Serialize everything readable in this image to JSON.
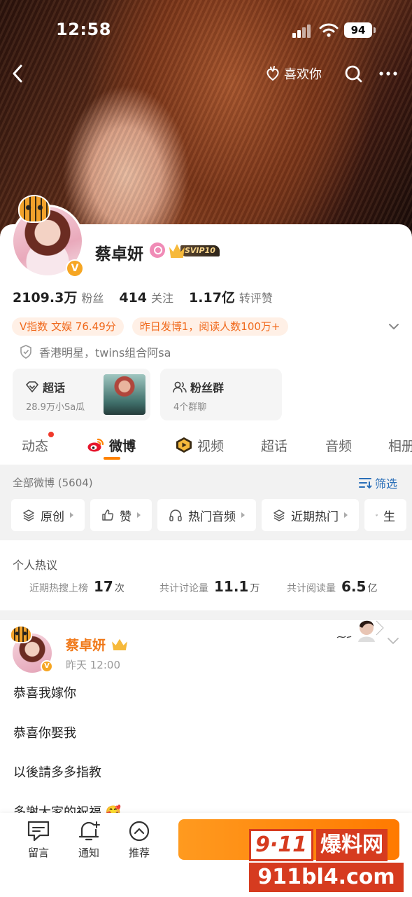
{
  "status_bar": {
    "time": "12:58",
    "battery": "94"
  },
  "nav": {
    "like_label": "喜欢你"
  },
  "profile": {
    "name": "蔡卓妍",
    "svip_label": "SVIP10",
    "stats": [
      {
        "value": "2109.3万",
        "label": "粉丝"
      },
      {
        "value": "414",
        "label": "关注"
      },
      {
        "value": "1.17亿",
        "label": "转评赞"
      }
    ],
    "chips": [
      "V指数 文娱 76.49分",
      "昨日发博1，阅读人数100万+"
    ],
    "intro": "香港明星，twins组合阿sa",
    "boxes": [
      {
        "title": "超话",
        "subtitle": "28.9万小Sa瓜"
      },
      {
        "title": "粉丝群",
        "subtitle": "4个群聊"
      }
    ]
  },
  "tabs": [
    "动态",
    "微博",
    "视频",
    "超话",
    "音频",
    "相册"
  ],
  "feed": {
    "all_label": "全部微博 (5604)",
    "filter_label": "筛选",
    "pills": [
      "原创",
      "赞",
      "热门音频",
      "近期热门",
      "生"
    ]
  },
  "hot": {
    "title": "个人热议",
    "items": [
      {
        "label": "近期热搜上榜",
        "value": "17",
        "unit": "次"
      },
      {
        "label": "共计讨论量",
        "value": "11.1",
        "unit": "万"
      },
      {
        "label": "共计阅读量",
        "value": "6.5",
        "unit": "亿"
      }
    ]
  },
  "post": {
    "author": "蔡卓妍",
    "time": "昨天 12:00",
    "lines": [
      "恭喜我嫁你",
      "恭喜你娶我",
      "以後請多多指教",
      "多謝大家的祝福 🥰"
    ]
  },
  "bottom_bar": {
    "items": [
      "留言",
      "通知",
      "推荐"
    ]
  },
  "watermark": {
    "logo": "9·11",
    "text": "爆料网",
    "url": "911bl4.com"
  },
  "colors": {
    "accent": "#ff8200",
    "link": "#2a6fb8",
    "chip_text": "#f0691c",
    "name_orange": "#f07818"
  }
}
